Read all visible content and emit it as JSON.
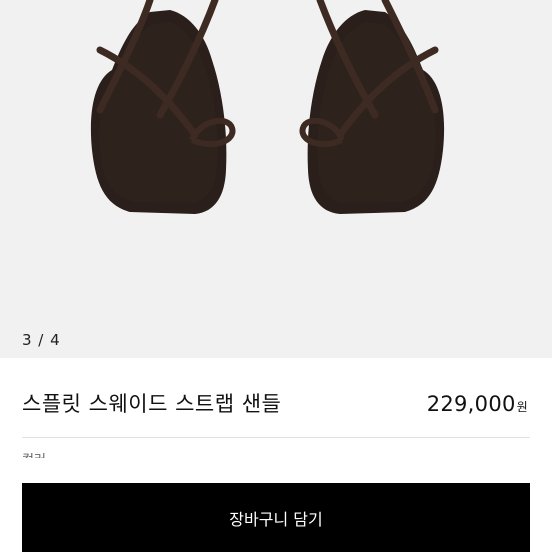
{
  "gallery": {
    "image_alt_icon": "sandal-photo",
    "counter": "3 / 4"
  },
  "product": {
    "name": "스플릿 스웨이드 스트랩 샌들",
    "price": "229,000",
    "currency": "원",
    "next_section_label": "컬러"
  },
  "actions": {
    "cart_label": "장바구니 담기"
  },
  "colors": {
    "sandal_sole": "#2a1f1a",
    "strap": "#3d2a22",
    "background": "#f1f1f1",
    "button": "#000000"
  }
}
